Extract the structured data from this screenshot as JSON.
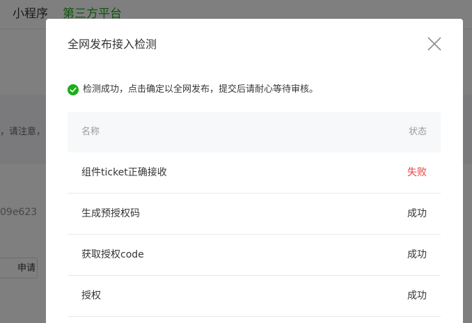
{
  "background": {
    "nav": {
      "items": [
        {
          "label": "小程序",
          "active": false
        },
        {
          "label": "第三方平台",
          "active": true
        }
      ]
    },
    "notice_fragment": "，请注意，",
    "hash_fragment": "09e623",
    "button_fragment": "申请"
  },
  "dialog": {
    "title": "全网发布接入检测",
    "success_message": "检测成功，点击确定以全网发布，提交后请耐心等待审核。",
    "table": {
      "headers": {
        "name": "名称",
        "status": "状态"
      },
      "rows": [
        {
          "name": "组件ticket正确接收",
          "status": "失败",
          "failed": true
        },
        {
          "name": "生成预授权码",
          "status": "成功",
          "failed": false
        },
        {
          "name": "获取授权code",
          "status": "成功",
          "failed": false
        },
        {
          "name": "授权",
          "status": "成功",
          "failed": false
        }
      ]
    }
  },
  "colors": {
    "success": "#1aad19",
    "fail": "#e64340",
    "text": "#353535",
    "muted": "#9a9a9a",
    "header_bg": "#f6f8f9"
  },
  "icons": {
    "close": "close-icon",
    "success": "check-circle-icon"
  }
}
